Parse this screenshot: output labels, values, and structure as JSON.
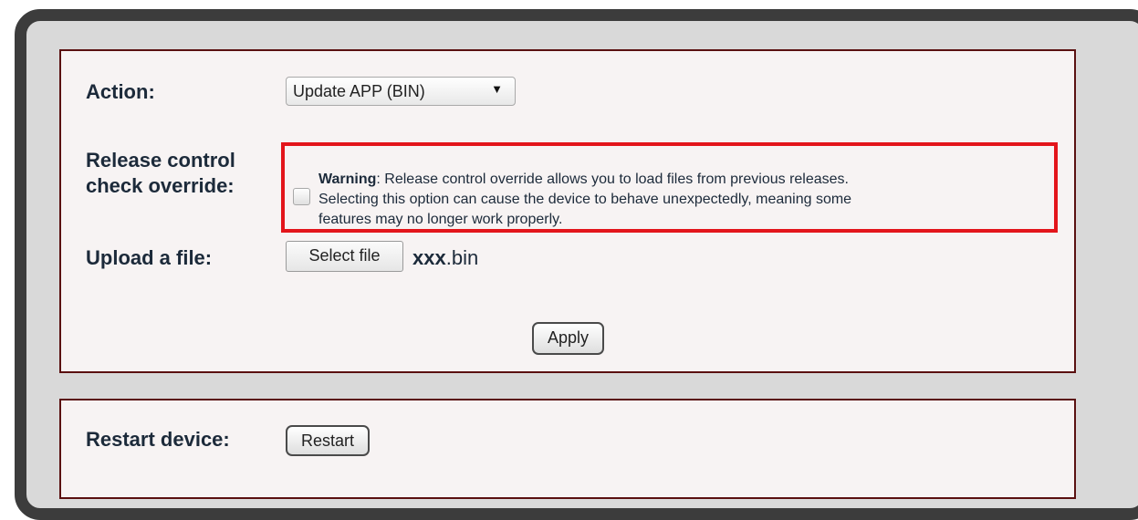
{
  "update_panel": {
    "action_label": "Action:",
    "action_value": "Update APP (BIN)",
    "action_arrow": "▼",
    "override_label_line1": "Release control",
    "override_label_line2": "check override:",
    "warning_bold": "Warning",
    "warning_line1_rest": ": Release control override allows you to load files from previous releases.",
    "warning_line2": "Selecting this option can cause the device to behave unexpectedly, meaning some",
    "warning_line3": "features may no longer work properly.",
    "upload_label": "Upload a file:",
    "select_file_button": "Select file",
    "file_name_bold": "xxx",
    "file_name_ext": ".bin",
    "apply_button": "Apply"
  },
  "restart_panel": {
    "restart_label": "Restart device:",
    "restart_button": "Restart"
  },
  "colors": {
    "panel_border": "#5a1010",
    "warning_highlight": "#e3151b",
    "frame": "#3c3c3c",
    "frame_fill": "#d9d9d9"
  }
}
